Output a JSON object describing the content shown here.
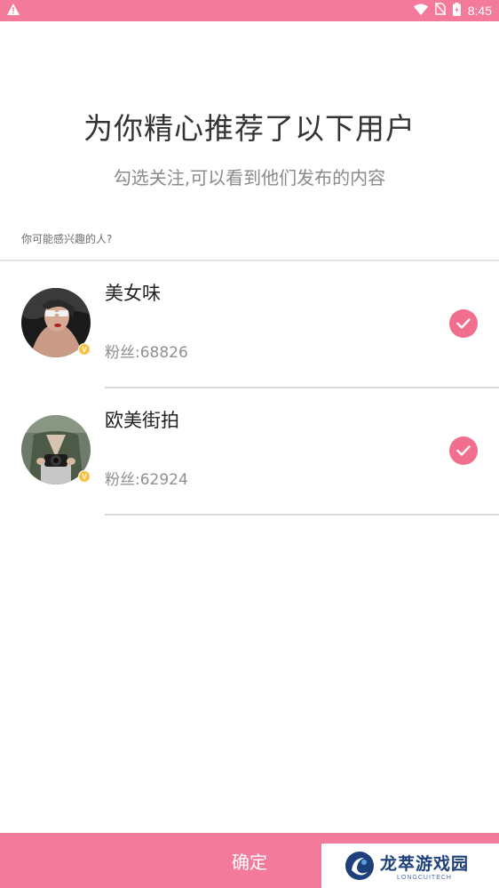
{
  "status_bar": {
    "time": "8:45",
    "icons": [
      "warning-icon",
      "wifi-icon",
      "no-sim-icon",
      "battery-charging-icon"
    ]
  },
  "header": {
    "title": "为你精心推荐了以下用户",
    "subtitle": "勾选关注,可以看到他们发布的内容"
  },
  "section": {
    "label": "你可能感兴趣的人?"
  },
  "users": [
    {
      "name": "美女味",
      "fans": "粉丝:68826",
      "checked": true,
      "verified": true
    },
    {
      "name": "欧美街拍",
      "fans": "粉丝:62924",
      "checked": true,
      "verified": true
    }
  ],
  "footer": {
    "confirm_label": "确定"
  },
  "watermark": {
    "cn": "龙萃游戏园",
    "en": "LONGCUITECH"
  },
  "colors": {
    "accent": "#f47a9b",
    "check": "#f16f8d",
    "badge": "#f6c343"
  }
}
